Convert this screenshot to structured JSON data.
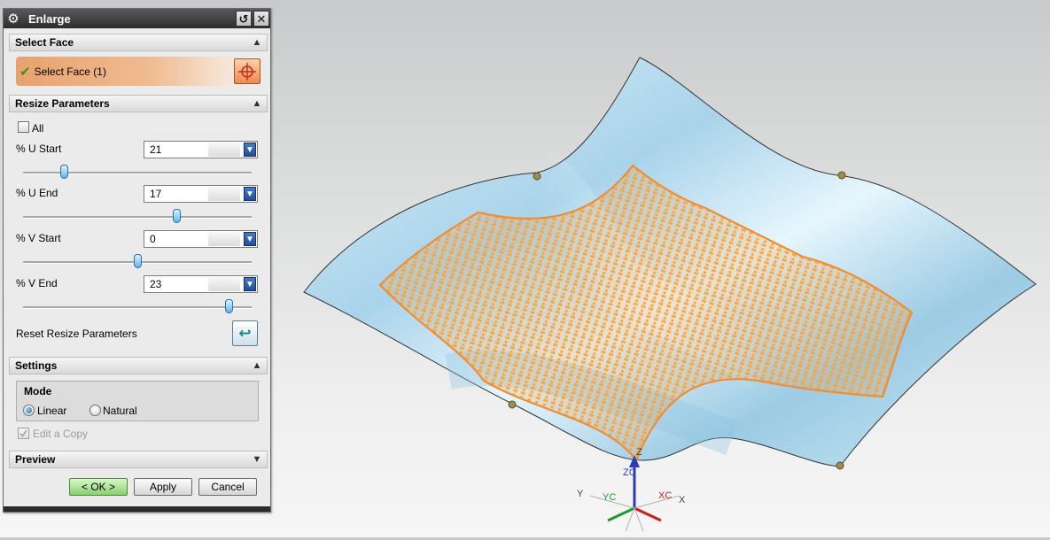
{
  "dialog": {
    "title": "Enlarge",
    "sections": {
      "select_face": "Select Face",
      "resize_parameters": "Resize Parameters",
      "settings": "Settings",
      "preview": "Preview"
    },
    "select_face_label": "Select Face (1)",
    "all_label": "All",
    "params": [
      {
        "label": "% U Start",
        "value": "21",
        "slider_fraction": 0.18
      },
      {
        "label": "% U End",
        "value": "17",
        "slider_fraction": 0.67
      },
      {
        "label": "% V Start",
        "value": "0",
        "slider_fraction": 0.5
      },
      {
        "label": "% V End",
        "value": "23",
        "slider_fraction": 0.9
      }
    ],
    "reset_label": "Reset Resize Parameters",
    "mode": {
      "label": "Mode",
      "options": [
        "Linear",
        "Natural"
      ],
      "selected": "Linear"
    },
    "edit_copy_label": "Edit a Copy",
    "buttons": {
      "ok": "< OK >",
      "apply": "Apply",
      "cancel": "Cancel"
    }
  },
  "viewport": {
    "axes": {
      "z": "Z",
      "zc": "ZC",
      "y": "Y",
      "yc": "YC",
      "x": "X",
      "xc": "XC"
    },
    "colors": {
      "surface": "#bfe2f3",
      "highlight": "#f5a442",
      "handle": "#9e8c4f"
    }
  },
  "icons": {
    "title": "gear-icon",
    "reset": "reset-icon",
    "close": "close-icon",
    "select_face": "crosshair-icon",
    "reset_params": "return-arrow-icon"
  }
}
